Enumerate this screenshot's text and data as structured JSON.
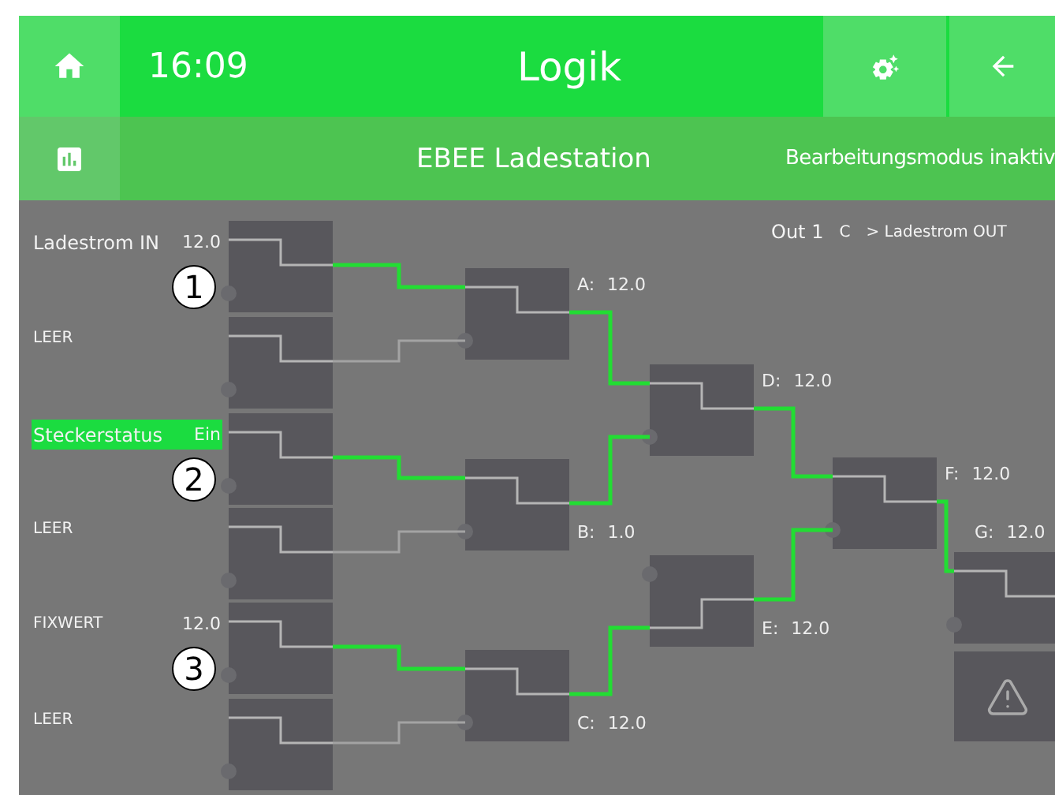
{
  "header": {
    "time": "16:09",
    "title": "Logik"
  },
  "subheader": {
    "title": "EBEE Ladestation",
    "mode": "Bearbeitungsmodus inaktiv"
  },
  "output": {
    "name": "Out 1",
    "source": "C",
    "arrow": ">",
    "target": "Ladestrom OUT"
  },
  "inputs": [
    {
      "name": "Ladestrom IN",
      "value": "12.0",
      "selected": false,
      "active": true,
      "marker": "1"
    },
    {
      "name": "LEER",
      "selected": false,
      "active": false
    },
    {
      "name": "Steckerstatus",
      "value": "Ein",
      "selected": true,
      "active": true,
      "marker": "2"
    },
    {
      "name": "LEER",
      "selected": false,
      "active": false
    },
    {
      "name": "FIXWERT",
      "value": "12.0",
      "selected": false,
      "active": true,
      "marker": "3"
    },
    {
      "name": "LEER",
      "selected": false,
      "active": false
    }
  ],
  "gates": [
    {
      "name": "A:",
      "value": "12.0",
      "active": true
    },
    {
      "name": "B:",
      "value": "1.0",
      "active": true
    },
    {
      "name": "C:",
      "value": "12.0",
      "active": true
    },
    {
      "name": "D:",
      "value": "12.0",
      "active": true
    },
    {
      "name": "E:",
      "value": "12.0",
      "active": true
    },
    {
      "name": "F:",
      "value": "12.0",
      "active": true
    },
    {
      "name": "G:",
      "value": "12.0"
    }
  ]
}
